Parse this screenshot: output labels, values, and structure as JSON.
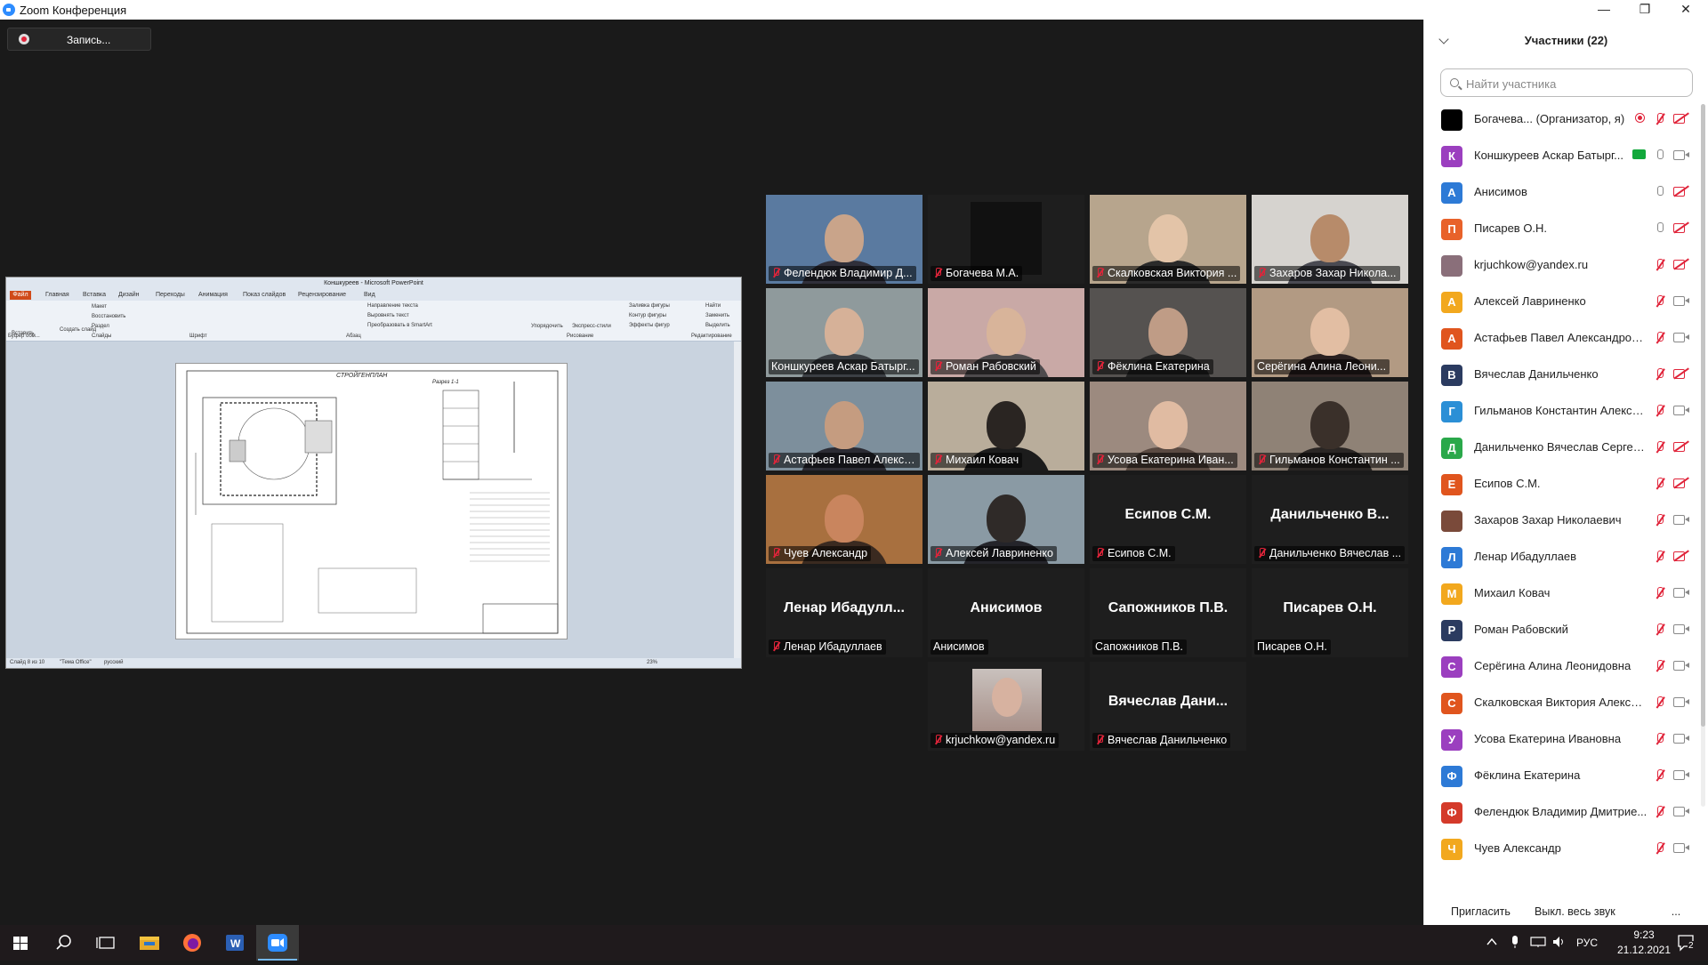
{
  "window": {
    "title": "Zoom Конференция",
    "minimize": "—",
    "restore": "❐",
    "close": "✕"
  },
  "recording": {
    "label": "Запись..."
  },
  "share": {
    "title": "Коншкуреев - Microsoft PowerPoint",
    "tabs": [
      "Файл",
      "Главная",
      "Вставка",
      "Дизайн",
      "Переходы",
      "Анимация",
      "Показ слайдов",
      "Рецензирование",
      "Вид"
    ],
    "groups": [
      "Буфер обм...",
      "Слайды",
      "Шрифт",
      "Абзац",
      "Рисование",
      "Редактирование"
    ],
    "ribbon_items": [
      "Вставить",
      "Создать слайд",
      "Макет",
      "Восстановить",
      "Раздел",
      "Направление текста",
      "Выровнять текст",
      "Преобразовать в SmartArt",
      "Упорядочить",
      "Экспресс-стили",
      "Заливка фигуры",
      "Контур фигуры",
      "Эффекты фигур",
      "Найти",
      "Заменить",
      "Выделить"
    ],
    "slide_title": "СТРОЙГЕНПЛАН",
    "slide_subtitle": "Разрез 1-1",
    "status": {
      "slide": "Слайд 8 из 10",
      "theme": "\"Тема Office\"",
      "lang": "русский",
      "zoom": "23%"
    }
  },
  "tiles": [
    {
      "name": "Фелендюк Владимир Д...",
      "muted": true,
      "type": "video",
      "bg": "#5a7aa0",
      "face": "#c9a48a",
      "body": "#2f2f3a"
    },
    {
      "name": "Богачева М.А.",
      "muted": true,
      "type": "dark"
    },
    {
      "name": "Скалковская Виктория ...",
      "muted": true,
      "type": "video",
      "bg": "#b7a58d",
      "face": "#e3c4a8",
      "body": "#2a2a2a"
    },
    {
      "name": "Захаров Захар Никола...",
      "muted": true,
      "type": "video",
      "bg": "#d6d3cf",
      "face": "#b78b6a",
      "body": "#4a4a52"
    },
    {
      "name": "Коншкуреев Аскар Батырг...",
      "muted": false,
      "type": "video",
      "bg": "#8f9a9c",
      "face": "#d6b198",
      "body": "#3b3f44",
      "speaking": true
    },
    {
      "name": "Роман Рабовский",
      "muted": true,
      "type": "video",
      "bg": "#c9a9a6",
      "face": "#d8b49a",
      "body": "#4e4b4d"
    },
    {
      "name": "Фёклина Екатерина",
      "muted": true,
      "type": "video",
      "bg": "#555250",
      "face": "#bf9c86",
      "body": "#242424"
    },
    {
      "name": "Серёгина Алина Леони...",
      "muted": false,
      "type": "video",
      "bg": "#b29a83",
      "face": "#e2bea3",
      "body": "#2a2020"
    },
    {
      "name": "Астафьев Павел Алекса...",
      "muted": true,
      "type": "video",
      "bg": "#7d8f9c",
      "face": "#c59c80",
      "body": "#2b2b33"
    },
    {
      "name": "Михаил Ковач",
      "muted": true,
      "type": "video",
      "bg": "#b9ad9b",
      "face": "#2a2522",
      "body": "#1c1c1c"
    },
    {
      "name": "Усова Екатерина Иван...",
      "muted": true,
      "type": "video",
      "bg": "#9c8a7f",
      "face": "#e0bba2",
      "body": "#5a4a42"
    },
    {
      "name": "Гильманов Константин ...",
      "muted": true,
      "type": "video",
      "bg": "#8f8276",
      "face": "#3a302a",
      "body": "#2a2624"
    },
    {
      "name": "Чуев Александр",
      "muted": true,
      "type": "video",
      "bg": "#a8703f",
      "face": "#c9855e",
      "body": "#3a2a20"
    },
    {
      "name": "Алексей Лавриненко",
      "muted": true,
      "type": "video",
      "bg": "#8a9aa4",
      "face": "#2f2a28",
      "body": "#24242a"
    },
    {
      "name": "Есипов С.М.",
      "muted": true,
      "type": "text",
      "big": "Есипов С.М."
    },
    {
      "name": "Данильченко Вячеслав ...",
      "muted": true,
      "type": "text",
      "big": "Данильченко  В..."
    },
    {
      "name": "Ленар Ибадуллаев",
      "muted": true,
      "type": "text",
      "big": "Ленар  Ибадулл..."
    },
    {
      "name": "Анисимов",
      "muted": false,
      "type": "text",
      "big": "Анисимов"
    },
    {
      "name": "Сапожников П.В.",
      "muted": false,
      "type": "text",
      "big": "Сапожников П.В."
    },
    {
      "name": "Писарев О.Н.",
      "muted": false,
      "type": "text",
      "big": "Писарев О.Н."
    },
    {
      "name": "krjuchkow@yandex.ru",
      "muted": true,
      "type": "avatar"
    },
    {
      "name": "Вячеслав Данильченко",
      "muted": true,
      "type": "text",
      "big": "Вячеслав  Дани..."
    }
  ],
  "panel": {
    "title": "Участники (22)",
    "search_placeholder": "Найти участника",
    "invite": "Пригласить",
    "mute_all": "Выкл. весь звук",
    "more": "...",
    "participants": [
      {
        "initial": "",
        "color": "#000000",
        "name": "Богачева...  (Организатор, я)",
        "mic": "off",
        "cam": "off",
        "rec": true
      },
      {
        "initial": "К",
        "color": "#9b3fbf",
        "name": "Коншкуреев Аскар Батырг...",
        "mic": "on",
        "cam": "on",
        "share": true
      },
      {
        "initial": "А",
        "color": "#2d7ad6",
        "name": "Анисимов",
        "mic": "on",
        "cam": "off"
      },
      {
        "initial": "П",
        "color": "#e8622a",
        "name": "Писарев О.Н.",
        "mic": "on",
        "cam": "off"
      },
      {
        "initial": "",
        "color": "#8a6f7a",
        "name": "krjuchkow@yandex.ru",
        "mic": "off",
        "cam": "off"
      },
      {
        "initial": "А",
        "color": "#f2a81e",
        "name": "Алексей Лавриненко",
        "mic": "off",
        "cam": "on"
      },
      {
        "initial": "А",
        "color": "#e0551e",
        "name": "Астафьев Павел Александрович",
        "mic": "off",
        "cam": "on"
      },
      {
        "initial": "В",
        "color": "#2b3b60",
        "name": "Вячеслав Данильченко",
        "mic": "off",
        "cam": "off"
      },
      {
        "initial": "Г",
        "color": "#2b8fd6",
        "name": "Гильманов Константин Алекса...",
        "mic": "off",
        "cam": "on"
      },
      {
        "initial": "Д",
        "color": "#2aa84a",
        "name": "Данильченко Вячеслав Сергее...",
        "mic": "off",
        "cam": "off"
      },
      {
        "initial": "Е",
        "color": "#e0551e",
        "name": "Есипов С.М.",
        "mic": "off",
        "cam": "off"
      },
      {
        "initial": "",
        "color": "#7a4a3a",
        "name": "Захаров Захар Николаевич",
        "mic": "off",
        "cam": "on"
      },
      {
        "initial": "Л",
        "color": "#2d7ad6",
        "name": "Ленар Ибадуллаев",
        "mic": "off",
        "cam": "off"
      },
      {
        "initial": "М",
        "color": "#f2a81e",
        "name": "Михаил Ковач",
        "mic": "off",
        "cam": "on"
      },
      {
        "initial": "Р",
        "color": "#2b3b60",
        "name": "Роман Рабовский",
        "mic": "off",
        "cam": "on"
      },
      {
        "initial": "С",
        "color": "#9b3fbf",
        "name": "Серёгина Алина Леонидовна",
        "mic": "off",
        "cam": "on"
      },
      {
        "initial": "С",
        "color": "#e0551e",
        "name": "Скалковская Виктория Алексан...",
        "mic": "off",
        "cam": "on"
      },
      {
        "initial": "У",
        "color": "#9b3fbf",
        "name": "Усова Екатерина Ивановна",
        "mic": "off",
        "cam": "on"
      },
      {
        "initial": "Ф",
        "color": "#2d7ad6",
        "name": "Фёклина Екатерина",
        "mic": "off",
        "cam": "on"
      },
      {
        "initial": "Ф",
        "color": "#d43a2a",
        "name": "Фелендюк Владимир Дмитрие...",
        "mic": "off",
        "cam": "on"
      },
      {
        "initial": "Ч",
        "color": "#f2a81e",
        "name": "Чуев Александр",
        "mic": "off",
        "cam": "on"
      }
    ]
  },
  "taskbar": {
    "apps": [
      "start-button",
      "search",
      "task-view",
      "explorer",
      "firefox",
      "word",
      "zoom"
    ],
    "lang": "РУС",
    "time": "9:23",
    "date": "21.12.2021",
    "notif": "2"
  }
}
